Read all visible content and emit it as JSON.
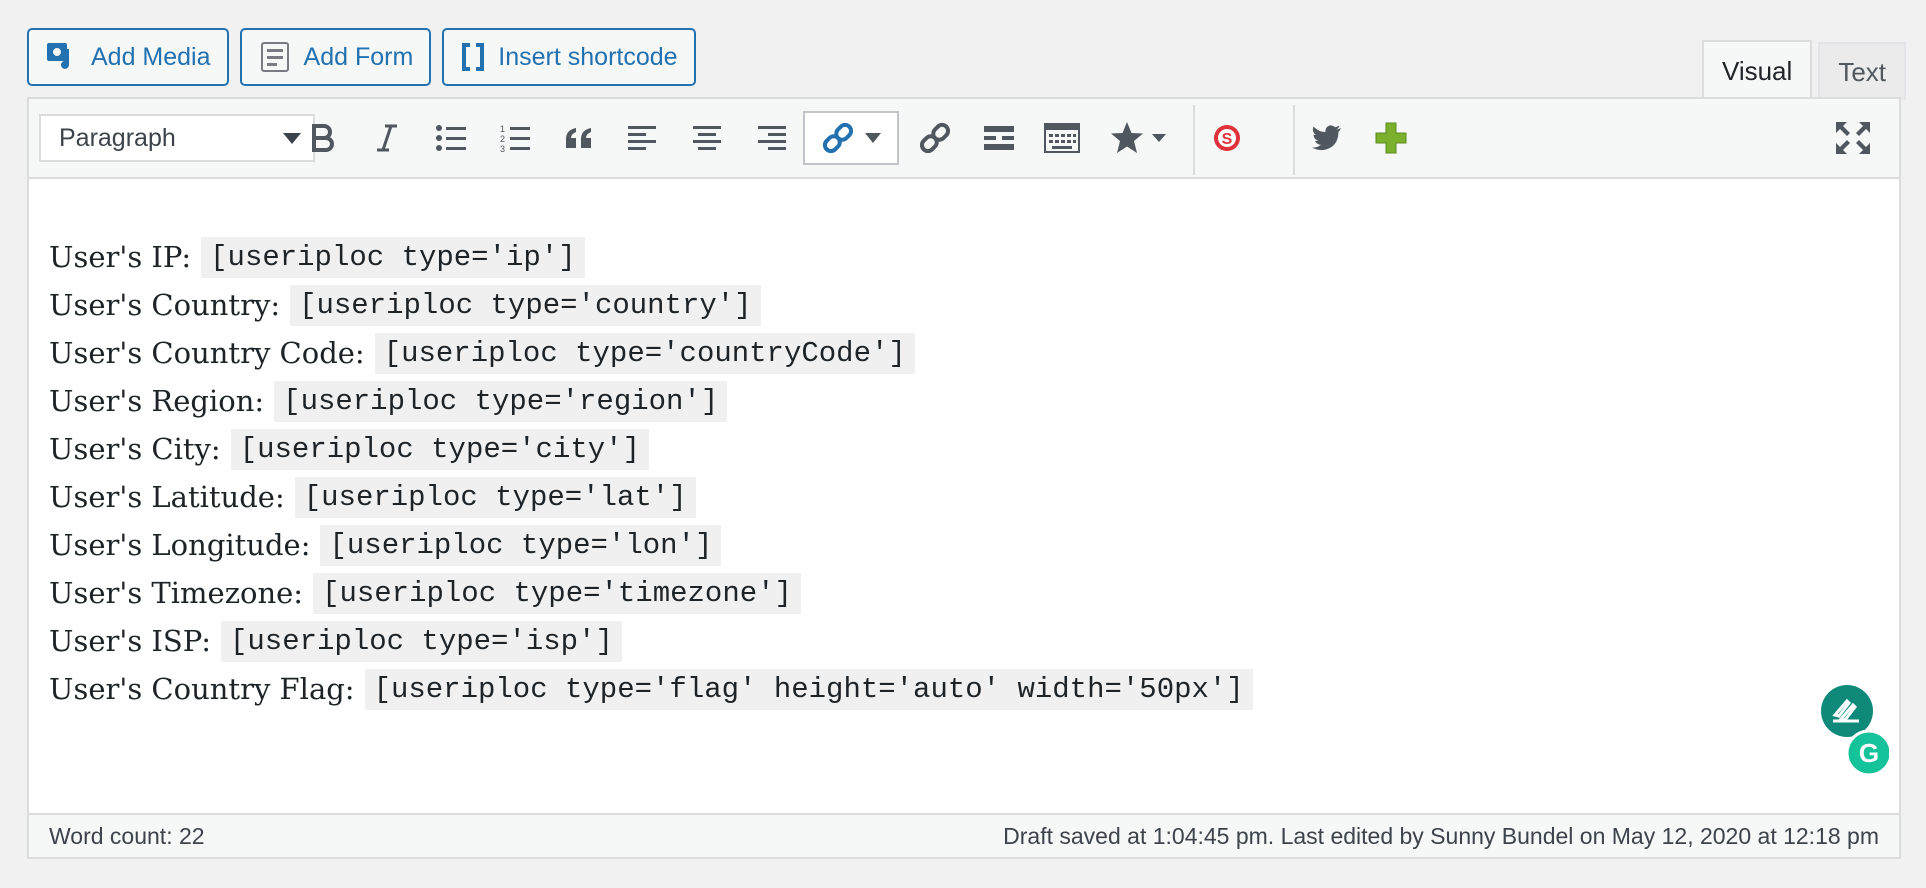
{
  "media_buttons": [
    {
      "label": "Add Media",
      "icon": "media-icon"
    },
    {
      "label": "Add Form",
      "icon": "form-icon"
    },
    {
      "label": "Insert shortcode",
      "icon": "shortcode-icon"
    }
  ],
  "tabs": {
    "visual": "Visual",
    "text": "Text",
    "active": "Visual"
  },
  "toolbar": {
    "format_select": "Paragraph",
    "buttons": [
      "bold-icon",
      "italic-icon",
      "bullet-list-icon",
      "numbered-list-icon",
      "blockquote-icon",
      "align-left-icon",
      "align-center-icon",
      "align-right-icon",
      "link-icon",
      "unlink-icon",
      "read-more-icon",
      "toolbar-toggle-icon",
      "star-icon",
      "s-plugin-icon",
      "twitter-icon",
      "plus-icon",
      "fullscreen-icon"
    ]
  },
  "content": {
    "lines": [
      {
        "label": "User's IP:",
        "code": "[useriploc type='ip']"
      },
      {
        "label": "User's Country:",
        "code": "[useriploc type='country']"
      },
      {
        "label": "User's Country Code:",
        "code": "[useriploc type='countryCode']"
      },
      {
        "label": "User's Region:",
        "code": "[useriploc type='region']"
      },
      {
        "label": "User's City:",
        "code": "[useriploc type='city']"
      },
      {
        "label": "User's Latitude:",
        "code": "[useriploc type='lat']"
      },
      {
        "label": "User's Longitude:",
        "code": "[useriploc type='lon']"
      },
      {
        "label": "User's Timezone:",
        "code": "[useriploc type='timezone']"
      },
      {
        "label": "User's ISP:",
        "code": "[useriploc type='isp']"
      },
      {
        "label": "User's Country Flag:",
        "code": "[useriploc type='flag' height='auto' width='50px']"
      }
    ]
  },
  "status": {
    "word_count": "Word count: 22",
    "draft_info": "Draft saved at 1:04:45 pm. Last edited by Sunny Bundel on May 12, 2020 at 12:18 pm"
  },
  "colors": {
    "accent": "#2271b1",
    "plus": "#7ab02c",
    "grammarly": "#15c39a",
    "s_plugin": "#e0323a"
  }
}
